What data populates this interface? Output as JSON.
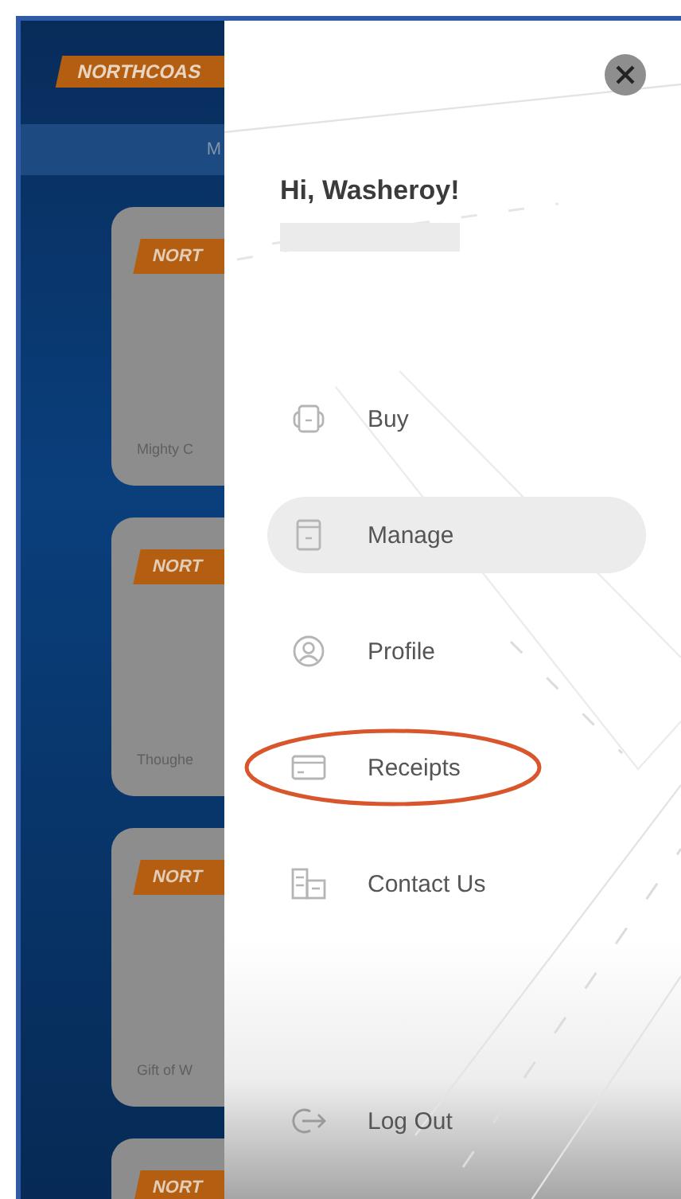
{
  "background": {
    "logo": "NORTHCOAS",
    "tab": "M",
    "cards": [
      {
        "logo": "NORT",
        "title": "Mighty C"
      },
      {
        "logo": "NORT",
        "title": "Thoughe"
      },
      {
        "logo": "NORT",
        "title": "Gift of W"
      },
      {
        "logo": "NORT"
      }
    ]
  },
  "drawer": {
    "greeting": "Hi, Washeroy!",
    "menu": [
      {
        "kind": "buy",
        "label": "Buy",
        "selected": false,
        "circled": false
      },
      {
        "kind": "manage",
        "label": "Manage",
        "selected": true,
        "circled": false
      },
      {
        "kind": "profile",
        "label": "Profile",
        "selected": false,
        "circled": false
      },
      {
        "kind": "receipts",
        "label": "Receipts",
        "selected": false,
        "circled": true
      },
      {
        "kind": "contact",
        "label": "Contact Us",
        "selected": false,
        "circled": false
      }
    ],
    "logout": {
      "label": "Log Out"
    }
  }
}
